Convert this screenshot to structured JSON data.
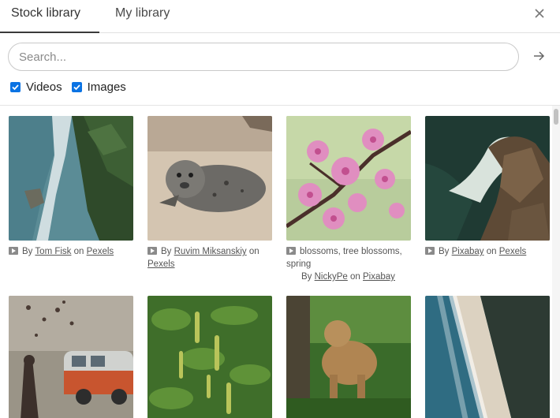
{
  "tabs": [
    {
      "label": "Stock library",
      "active": true
    },
    {
      "label": "My library",
      "active": false
    }
  ],
  "search": {
    "placeholder": "Search...",
    "value": ""
  },
  "filters": [
    {
      "label": "Videos",
      "checked": true
    },
    {
      "label": "Images",
      "checked": true
    }
  ],
  "colors": {
    "accent": "#0b73e3",
    "active_tab_underline": "#3a3a3a"
  },
  "items": [
    {
      "type": "video",
      "by": "By",
      "author": "Tom Fisk",
      "on": "on",
      "source": "Pexels"
    },
    {
      "type": "video",
      "by": "By",
      "author": "Ruvim Miksanskiy",
      "on": "on",
      "source": "Pexels"
    },
    {
      "type": "image",
      "description": "blossoms, tree blossoms, spring",
      "by": "By",
      "author": "NickyPe",
      "on": "on",
      "source": "Pixabay"
    },
    {
      "type": "video",
      "by": "By",
      "author": "Pixabay",
      "on": "on",
      "source": "Pexels"
    },
    {
      "type": "image"
    },
    {
      "type": "image"
    },
    {
      "type": "image"
    },
    {
      "type": "image"
    }
  ]
}
